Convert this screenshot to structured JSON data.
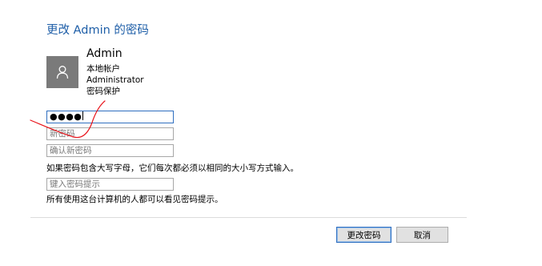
{
  "dialog": {
    "title": "更改 Admin 的密码"
  },
  "user": {
    "name": "Admin",
    "account_type": "本地帐户",
    "role": "Administrator",
    "protection": "密码保护"
  },
  "form": {
    "current_password_value": "●●●●",
    "new_password_placeholder": "新密码",
    "confirm_password_placeholder": "确认新密码",
    "case_note": "如果密码包含大写字母，它们每次都必须以相同的大小写方式输入。",
    "hint_placeholder": "键入密码提示",
    "hint_note": "所有使用这台计算机的人都可以看见密码提示。"
  },
  "buttons": {
    "change_label": "更改密码",
    "cancel_label": "取消"
  },
  "colors": {
    "title": "#1f5fa8",
    "avatar_bg": "#7a7a7a",
    "annotation": "#e8131a",
    "focus_border": "#2f6fc0"
  },
  "icons": {
    "avatar": "user-icon"
  }
}
